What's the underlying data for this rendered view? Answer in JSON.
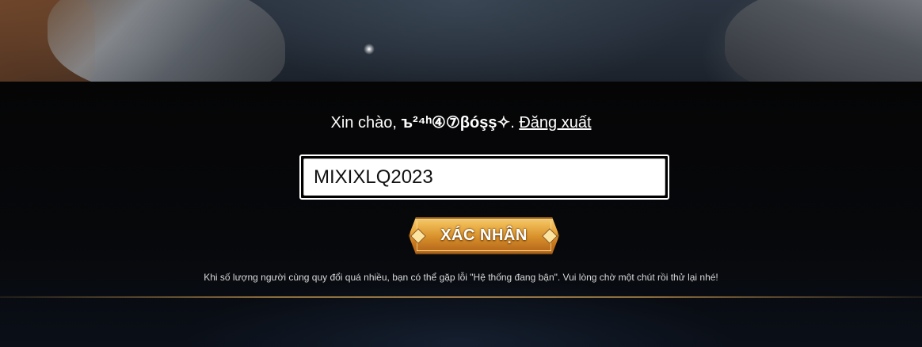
{
  "greeting": {
    "prefix": "Xin chào, ",
    "username": "ъ²⁴ʰ④⑦βóşş✧",
    "separator": ". ",
    "logout_label": "Đăng xuất"
  },
  "code_input": {
    "value": "MIXIXLQ2023"
  },
  "confirm_button": {
    "label": "XÁC NHẬN"
  },
  "notice": {
    "text": "Khi số lượng người cùng quy đổi quá nhiều, bạn có thể gặp lỗi \"Hệ thống đang bận\". Vui lòng chờ một chút rồi thử lại nhé!"
  },
  "colors": {
    "background": "#050609",
    "button_gold": "#e9a53a",
    "divider_gold": "#9c7a45"
  }
}
